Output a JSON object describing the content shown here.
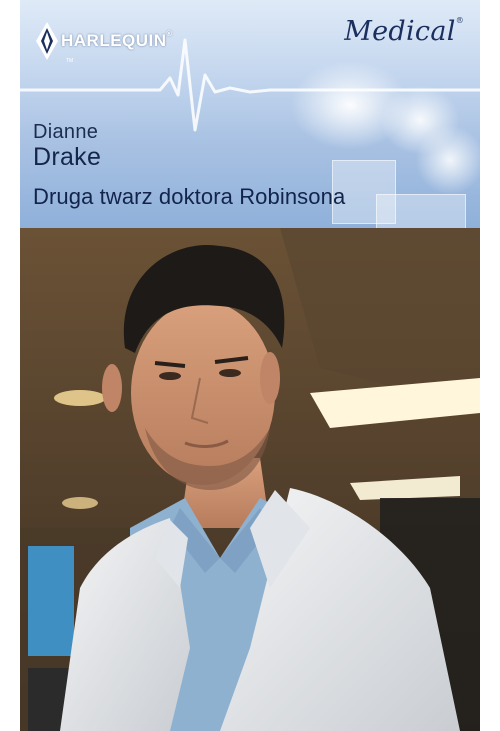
{
  "publisher": {
    "name": "HARLEQUIN",
    "registered_mark": "®",
    "trademark": "TM"
  },
  "series": {
    "name": "Medical",
    "registered_mark": "®"
  },
  "author": {
    "first_name": "Dianne",
    "last_name": "Drake"
  },
  "book": {
    "title": "Druga twarz doktora Robinsona"
  },
  "cover_image": {
    "subject": "man-in-white-doctor-coat",
    "setting": "hospital-corridor"
  },
  "colors": {
    "banner_top": "#dfeaf7",
    "banner_bottom": "#8fb0da",
    "title_text": "#13244a",
    "series_text": "#1b2f5e"
  }
}
